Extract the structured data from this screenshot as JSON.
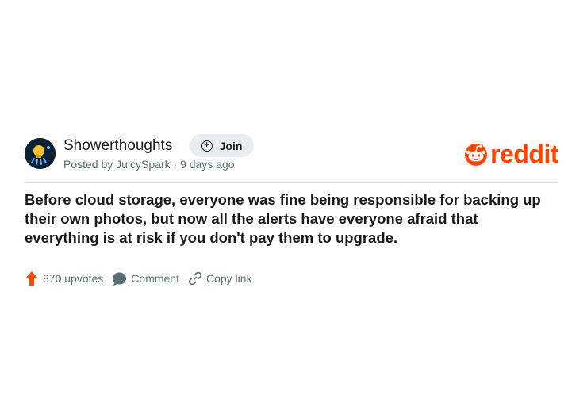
{
  "post": {
    "subreddit": "Showerthoughts",
    "join_label": "Join",
    "meta": "Posted by JuicySpark · 9 days ago",
    "title": "Before cloud storage, everyone was fine being responsible for backing up their own photos, but now all the alerts have everyone afraid that everything is at risk if you don't pay them to upgrade.",
    "upvotes_label": "870 upvotes",
    "comment_label": "Comment",
    "copy_link_label": "Copy link"
  },
  "brand": {
    "logo_text": "reddit",
    "accent_color": "#ff4500"
  },
  "icons": [
    "subreddit-avatar-icon",
    "plus-circle-icon",
    "reddit-alien-icon",
    "upvote-arrow-icon",
    "comment-bubble-icon",
    "link-icon"
  ]
}
